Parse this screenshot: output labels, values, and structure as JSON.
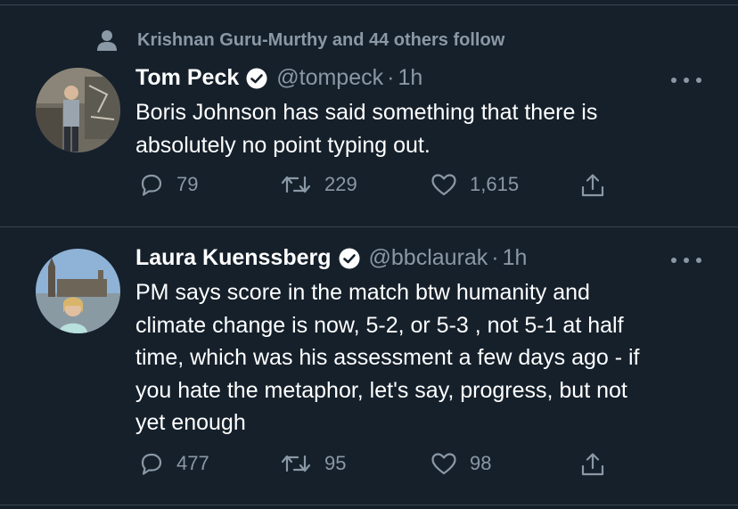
{
  "colors": {
    "background": "#15202b",
    "divider": "#38444d",
    "secondary_text": "#8b98a5",
    "primary_text": "#ffffff"
  },
  "social_context": {
    "icon": "person-icon",
    "text": "Krishnan Guru-Murthy and 44 others follow"
  },
  "tweets": [
    {
      "name": "Tom Peck",
      "verified": true,
      "handle": "@tompeck",
      "separator": "·",
      "time": "1h",
      "text": "Boris Johnson has said something that there is\nabsolutely no point typing out.",
      "replies": "79",
      "retweets": "229",
      "likes": "1,615"
    },
    {
      "name": "Laura Kuenssberg",
      "verified": true,
      "handle": "@bbclaurak",
      "separator": "·",
      "time": "1h",
      "text": "PM says score in the match btw humanity and\nclimate change is now, 5-2, or 5-3 , not 5-1 at half\ntime, which was his assessment a few days ago - if\nyou hate the metaphor, let's say, progress, but not\nyet enough",
      "replies": "477",
      "retweets": "95",
      "likes": "98"
    }
  ]
}
